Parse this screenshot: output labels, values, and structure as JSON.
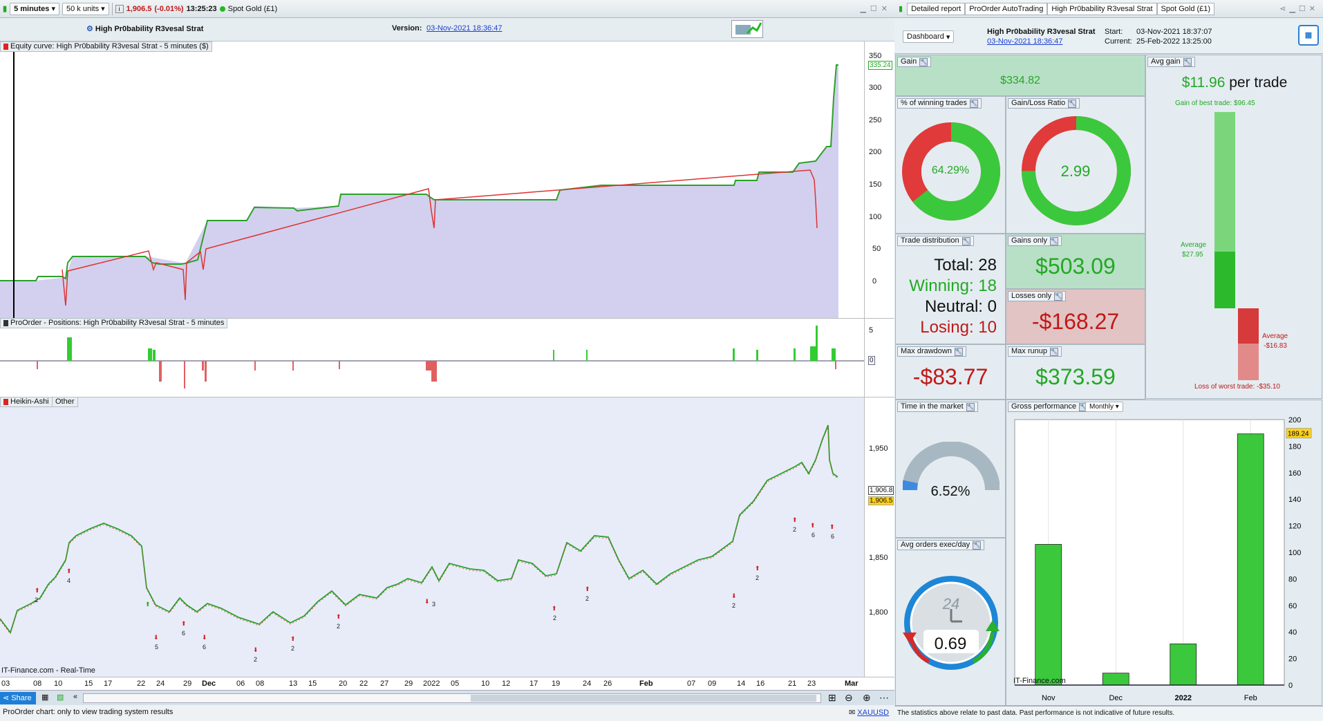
{
  "toolbar": {
    "timeframe": "5 minutes",
    "units": "50 k units",
    "price": "1,906.5",
    "change": "(-0.01%)",
    "time": "13:25:23",
    "instrument": "Spot Gold (£1)"
  },
  "strategy": {
    "name": "High Pr0bability R3vesal Strat",
    "version_label": "Version:",
    "version_date": "03-Nov-2021 18:36:47"
  },
  "panels": {
    "equity": "Equity curve: High Pr0bability R3vesal Strat - 5 minutes ($)",
    "positions": "ProOrder - Positions: High Pr0bability R3vesal Strat - 5 minutes",
    "heikin": "Heikin-Ashi",
    "other": "Other",
    "watermark": "IT-Finance.com - Real-Time"
  },
  "equity_axis": {
    "ticks": [
      "350",
      "300",
      "250",
      "200",
      "150",
      "100",
      "50",
      "0"
    ],
    "last": "335.24"
  },
  "positions_axis": {
    "ticks": [
      "5",
      "0"
    ]
  },
  "price_axis": {
    "ticks": [
      "1,950",
      "1,850",
      "1,800"
    ],
    "last": "1,906.8",
    "current": "1,906.5"
  },
  "dates": [
    "03",
    "08",
    "10",
    "15",
    "17",
    "22",
    "24",
    "29",
    "Dec",
    "06",
    "08",
    "13",
    "15",
    "20",
    "22",
    "27",
    "29",
    "2022",
    "05",
    "10",
    "12",
    "17",
    "19",
    "24",
    "26",
    "Feb",
    "07",
    "09",
    "14",
    "16",
    "21",
    "23",
    "Mar"
  ],
  "bottom": {
    "share": "Share",
    "status": "ProOrder chart: only to view trading system results",
    "symbol": "XAUUSD"
  },
  "right": {
    "tabs": [
      "Detailed report",
      "ProOrder AutoTrading",
      "High Pr0bability R3vesal Strat",
      "Spot Gold (£1)"
    ],
    "dashboard": "Dashboard",
    "name": "High Pr0bability R3vesal Strat",
    "date": "03-Nov-2021 18:36:47",
    "start_label": "Start:",
    "start": "03-Nov-2021 18:37:07",
    "current_label": "Current:",
    "current": "25-Feb-2022 13:25:00",
    "gain_label": "Gain",
    "gain": "$334.82",
    "avg_gain_label": "Avg gain",
    "avg_gain": "$11.96",
    "per_trade": "per trade",
    "best_trade": "Gain of best trade: $96.45",
    "avg_win_label": "Average",
    "avg_win": "$27.95",
    "avg_loss_label": "Average",
    "avg_loss": "-$16.83",
    "worst_trade": "Loss of worst trade: -$35.10",
    "win_pct_label": "% of winning trades",
    "win_pct": "64.29%",
    "win_frac": 0.6429,
    "gl_label": "Gain/Loss Ratio",
    "gl": "2.99",
    "gl_frac": 0.749,
    "dist_label": "Trade distribution",
    "total": "Total: 28",
    "winning": "Winning: 18",
    "neutral": "Neutral: 0",
    "losing": "Losing: 10",
    "gains_only_label": "Gains only",
    "gains_only": "$503.09",
    "losses_only_label": "Losses only",
    "losses_only": "-$168.27",
    "dd_label": "Max drawdown",
    "dd": "-$83.77",
    "runup_label": "Max runup",
    "runup": "$373.59",
    "tim_label": "Time in the market",
    "tim": "6.52%",
    "tim_frac": 0.0652,
    "aoe_label": "Avg orders exec/day",
    "aoe": "0.69",
    "clock": "24",
    "gp_label": "Gross performance",
    "gp_period": "Monthly",
    "gp_last": "189.24",
    "watermark": "IT-Finance.com",
    "footer": "The statistics above relate to past data. Past performance is not indicative of future results."
  },
  "chart_data": {
    "type": "bar",
    "categories": [
      "Nov",
      "Dec",
      "2022",
      "Feb"
    ],
    "values": [
      106,
      9,
      31,
      189.24
    ],
    "ylim": [
      0,
      200
    ],
    "yticks": [
      0,
      20,
      40,
      60,
      80,
      100,
      120,
      140,
      160,
      180,
      200
    ]
  }
}
